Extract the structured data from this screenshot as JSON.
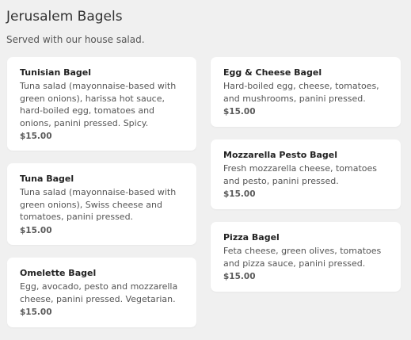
{
  "section": {
    "title": "Jerusalem Bagels",
    "subtitle": "Served with our house salad."
  },
  "items": [
    {
      "name": "Tunisian Bagel",
      "description": "Tuna salad (mayonnaise-based with green onions), harissa hot sauce, hard-boiled egg, tomatoes and onions, panini pressed. Spicy.",
      "price": "$15.00"
    },
    {
      "name": "Tuna Bagel",
      "description": "Tuna salad (mayonnaise-based with green onions), Swiss cheese and tomatoes, panini pressed.",
      "price": "$15.00"
    },
    {
      "name": "Omelette Bagel",
      "description": "Egg, avocado, pesto and mozzarella cheese, panini pressed. Vegetarian.",
      "price": "$15.00"
    },
    {
      "name": "Egg & Cheese Bagel",
      "description": "Hard-boiled egg, cheese, tomatoes, and mushrooms, panini pressed.",
      "price": "$15.00"
    },
    {
      "name": "Mozzarella Pesto Bagel",
      "description": "Fresh mozzarella cheese, tomatoes and pesto, panini pressed.",
      "price": "$15.00"
    },
    {
      "name": "Pizza Bagel",
      "description": "Feta cheese, green olives, tomatoes and pizza sauce, panini pressed.",
      "price": "$15.00"
    }
  ]
}
